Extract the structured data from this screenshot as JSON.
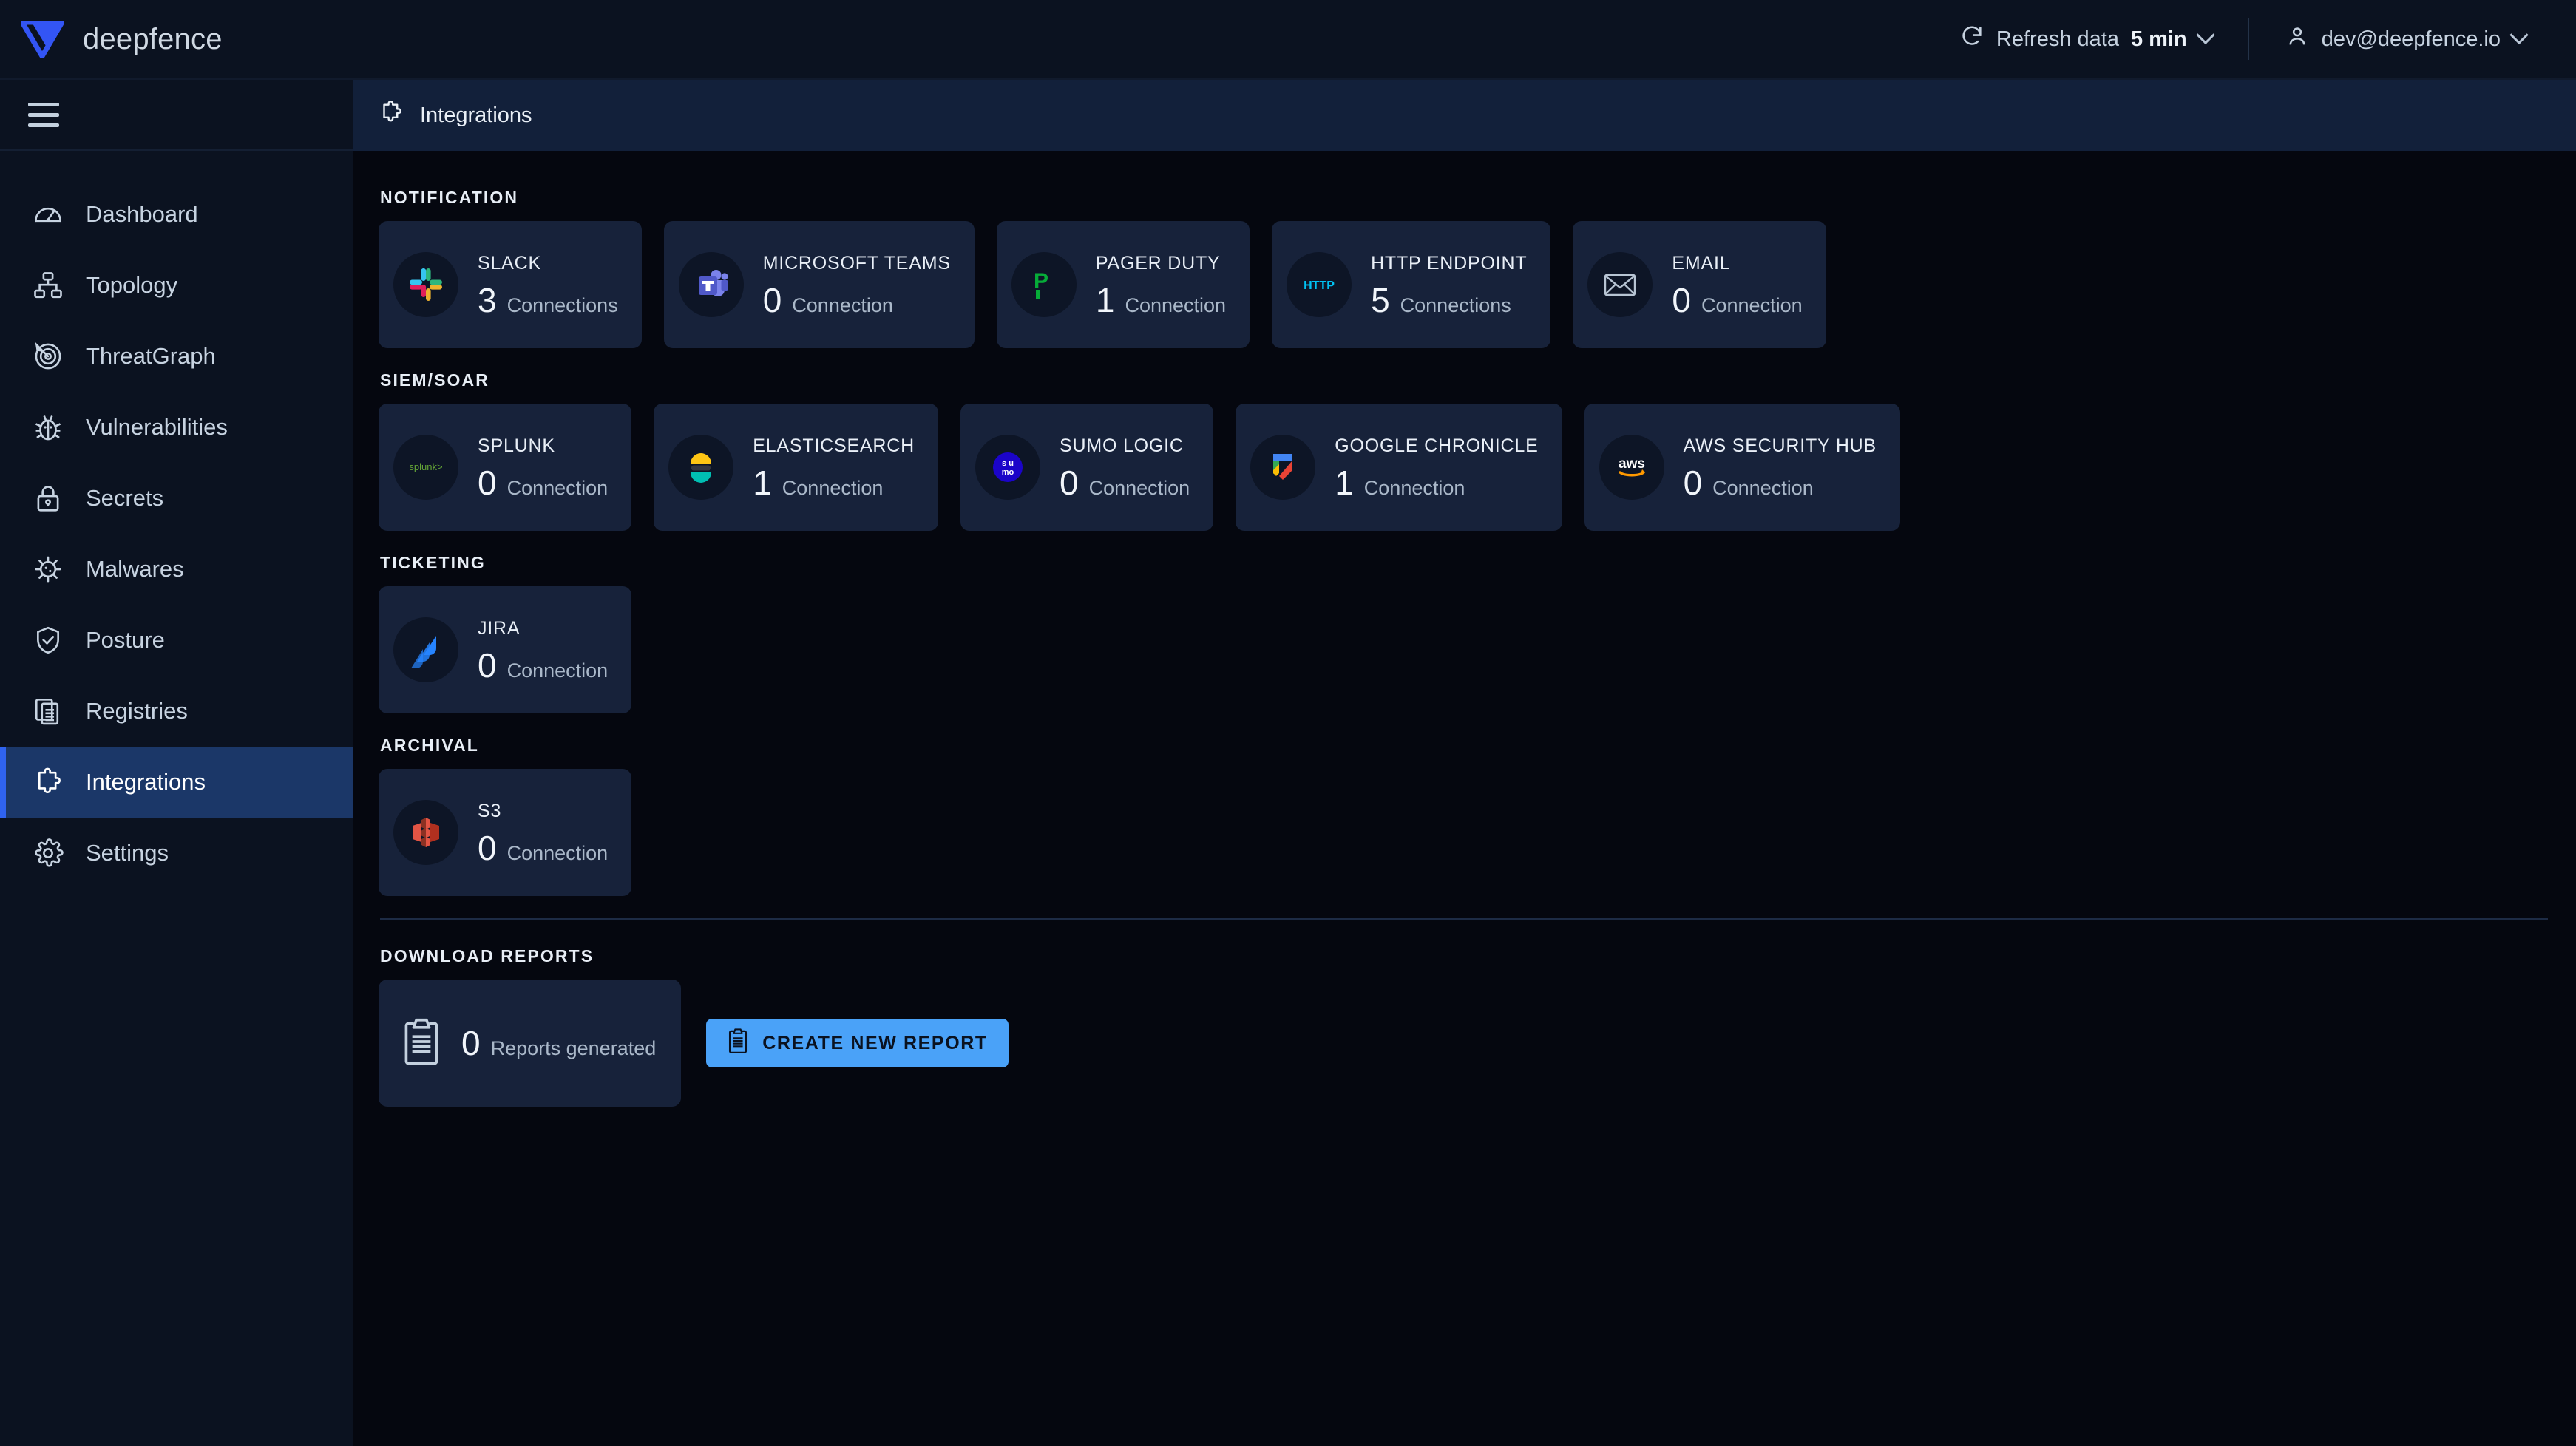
{
  "topbar": {
    "brand_name": "deepfence",
    "brand_logo_icon": "deepfence-logo",
    "refresh_label": "Refresh data",
    "refresh_value": "5 min",
    "refresh_icon": "refresh-icon",
    "user_email": "dev@deepfence.io",
    "user_icon": "user-icon",
    "chevron_icon": "chevron-down-icon"
  },
  "sidebar": {
    "menu_icon": "hamburger-icon",
    "items": [
      {
        "label": "Dashboard",
        "icon": "speedometer-icon",
        "active": false
      },
      {
        "label": "Topology",
        "icon": "org-chart-icon",
        "active": false
      },
      {
        "label": "ThreatGraph",
        "icon": "radar-target-icon",
        "active": false
      },
      {
        "label": "Vulnerabilities",
        "icon": "bug-icon",
        "active": false
      },
      {
        "label": "Secrets",
        "icon": "lock-icon",
        "active": false
      },
      {
        "label": "Malwares",
        "icon": "virus-icon",
        "active": false
      },
      {
        "label": "Posture",
        "icon": "shield-check-icon",
        "active": false
      },
      {
        "label": "Registries",
        "icon": "documents-icon",
        "active": false
      },
      {
        "label": "Integrations",
        "icon": "puzzle-icon",
        "active": true
      },
      {
        "label": "Settings",
        "icon": "gear-icon",
        "active": false
      }
    ]
  },
  "page": {
    "title": "Integrations",
    "title_icon": "puzzle-icon"
  },
  "sections": [
    {
      "title": "NOTIFICATION",
      "cards": [
        {
          "name": "SLACK",
          "count": "3",
          "unit": "Connections",
          "icon": "slack-logo"
        },
        {
          "name": "MICROSOFT TEAMS",
          "count": "0",
          "unit": "Connection",
          "icon": "microsoft-teams-logo"
        },
        {
          "name": "PAGER DUTY",
          "count": "1",
          "unit": "Connection",
          "icon": "pagerduty-logo"
        },
        {
          "name": "HTTP ENDPOINT",
          "count": "5",
          "unit": "Connections",
          "icon": "http-logo"
        },
        {
          "name": "EMAIL",
          "count": "0",
          "unit": "Connection",
          "icon": "envelope-icon"
        }
      ]
    },
    {
      "title": "SIEM/SOAR",
      "cards": [
        {
          "name": "SPLUNK",
          "count": "0",
          "unit": "Connection",
          "icon": "splunk-logo"
        },
        {
          "name": "ELASTICSEARCH",
          "count": "1",
          "unit": "Connection",
          "icon": "elasticsearch-logo"
        },
        {
          "name": "SUMO LOGIC",
          "count": "0",
          "unit": "Connection",
          "icon": "sumologic-logo"
        },
        {
          "name": "GOOGLE CHRONICLE",
          "count": "1",
          "unit": "Connection",
          "icon": "google-chronicle-logo"
        },
        {
          "name": "AWS SECURITY HUB",
          "count": "0",
          "unit": "Connection",
          "icon": "aws-logo"
        }
      ]
    },
    {
      "title": "TICKETING",
      "cards": [
        {
          "name": "JIRA",
          "count": "0",
          "unit": "Connection",
          "icon": "jira-logo"
        }
      ]
    },
    {
      "title": "ARCHIVAL",
      "cards": [
        {
          "name": "S3",
          "count": "0",
          "unit": "Connection",
          "icon": "aws-s3-logo"
        }
      ]
    }
  ],
  "reports": {
    "title": "DOWNLOAD REPORTS",
    "count": "0",
    "unit": "Reports generated",
    "card_icon": "clipboard-icon",
    "button_label": "CREATE NEW REPORT",
    "button_icon": "clipboard-icon"
  },
  "colors": {
    "page_background": "#05070f",
    "panel_background": "#0b1220",
    "card_background": "#17223a",
    "accent_active": "#2f63f0",
    "accent_active_bg": "#1b3768",
    "primary_button": "#4aa2f8",
    "header_bar": "#12203a",
    "text_primary": "#e9eff7",
    "text_muted": "#aab8c9"
  }
}
